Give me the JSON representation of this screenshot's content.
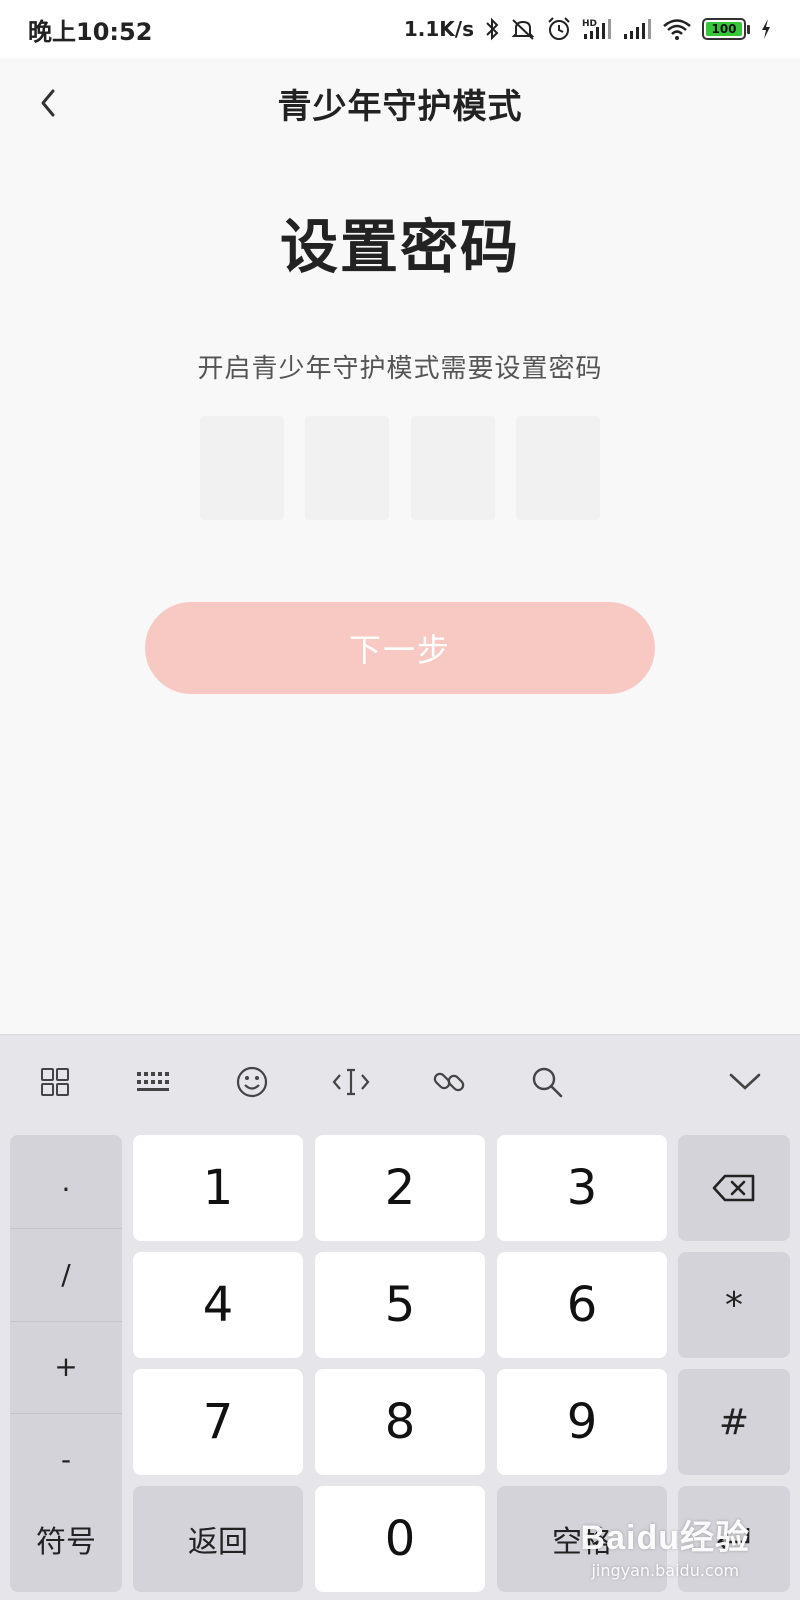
{
  "status_bar": {
    "time": "晚上10:52",
    "net_speed": "1.1K/s",
    "battery": "100",
    "icons": [
      "bluetooth-icon",
      "mute-icon",
      "alarm-icon",
      "hd-signal-icon",
      "signal-icon",
      "wifi-icon",
      "battery-icon",
      "charging-icon"
    ]
  },
  "header": {
    "title": "青少年守护模式",
    "back_icon": "chevron-left-icon"
  },
  "main": {
    "title": "设置密码",
    "subtitle": "开启青少年守护模式需要设置密码",
    "pin_length": 4,
    "next_label": "下一步",
    "next_color": "#f8c9c3"
  },
  "keyboard": {
    "toolbar_icons": [
      "grid-icon",
      "keyboard-icon",
      "emoji-icon",
      "cursor-icon",
      "link-icon",
      "search-icon",
      "chevron-down-icon"
    ],
    "side_keys": [
      ".",
      "/",
      "+",
      "-"
    ],
    "digits": [
      "1",
      "2",
      "3",
      "4",
      "5",
      "6",
      "7",
      "8",
      "9",
      "0"
    ],
    "right_keys": [
      "*",
      "#"
    ],
    "bottom": {
      "symbols": "符号",
      "back": "返回",
      "space": "空格"
    },
    "backspace_icon": "backspace-icon",
    "enter_icon": "enter-icon"
  },
  "watermark": {
    "main": "Baidu经验",
    "sub": "jingyan.baidu.com"
  }
}
